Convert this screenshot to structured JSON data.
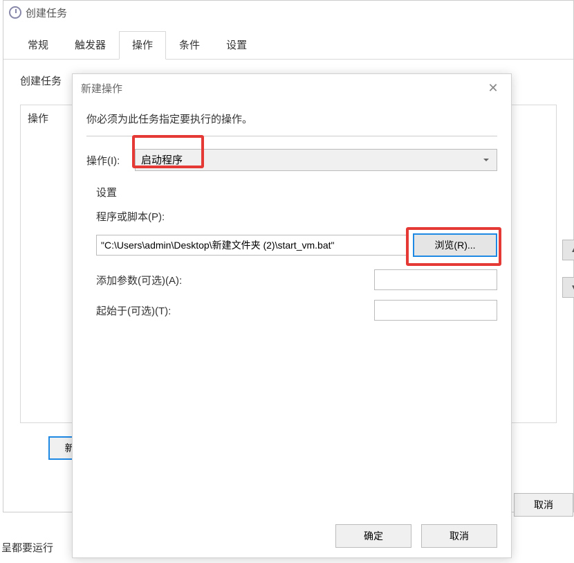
{
  "parent": {
    "title": "创建任务",
    "tabs": [
      "常规",
      "触发器",
      "操作",
      "条件",
      "设置"
    ],
    "active_tab_index": 2,
    "desc_partial": "创建任务",
    "col_header": "操作",
    "new_button": "新建(N",
    "cancel_button": "取消",
    "bottom_partial": "呈都要运行"
  },
  "modal": {
    "title": "新建操作",
    "instruction": "你必须为此任务指定要执行的操作。",
    "action_label": "操作(I):",
    "action_value": "启动程序",
    "settings_label": "设置",
    "program_label": "程序或脚本(P):",
    "program_value": "\"C:\\Users\\admin\\Desktop\\新建文件夹 (2)\\start_vm.bat\"",
    "browse_label": "浏览(R)...",
    "args_label": "添加参数(可选)(A):",
    "args_value": "",
    "startin_label": "起始于(可选)(T):",
    "startin_value": "",
    "ok": "确定",
    "cancel": "取消"
  }
}
